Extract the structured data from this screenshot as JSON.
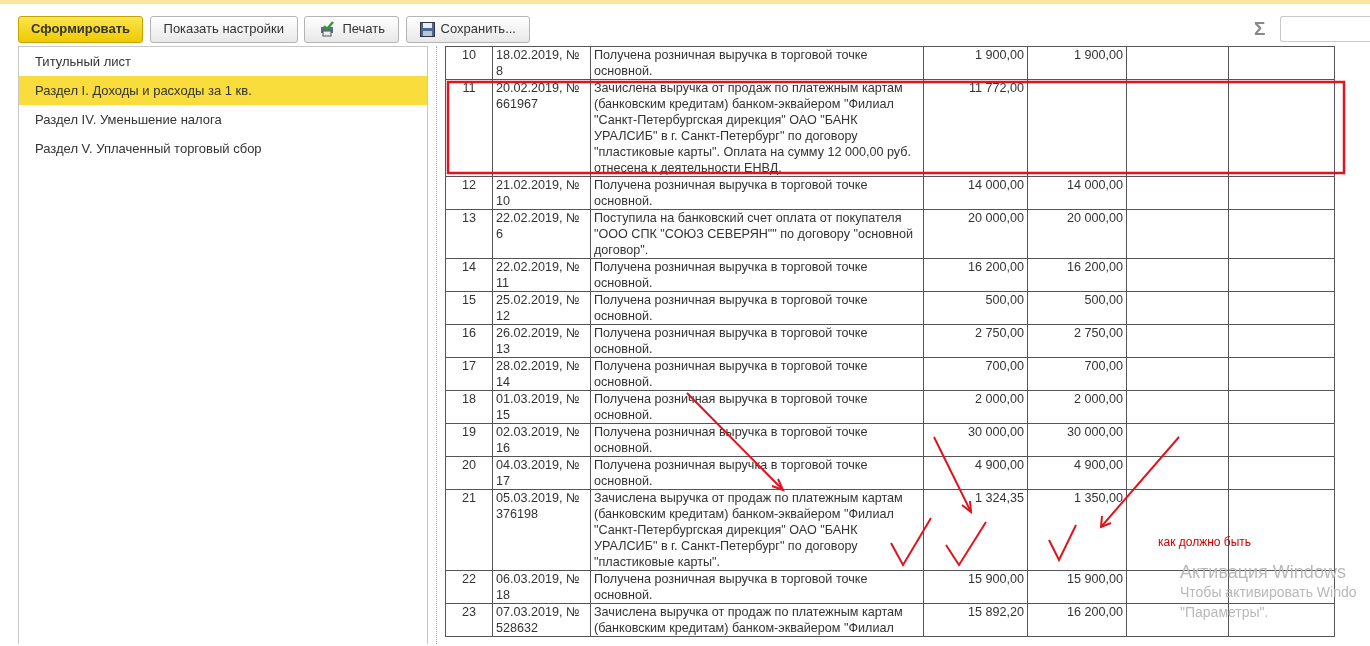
{
  "toolbar": {
    "buttons": [
      {
        "label": "Сформировать",
        "kind": "primary"
      },
      {
        "label": "Показать настройки",
        "kind": "plain"
      },
      {
        "label": "Печать",
        "kind": "print"
      },
      {
        "label": "Сохранить...",
        "kind": "save"
      }
    ],
    "sum_sign": "Σ"
  },
  "sidebar": {
    "items": [
      {
        "label": "Титульный лист",
        "selected": false
      },
      {
        "label": "Раздел I. Доходы и расходы за 1 кв.",
        "selected": true
      },
      {
        "label": "Раздел IV. Уменьшение налога",
        "selected": false
      },
      {
        "label": "Раздел V. Уплаченный торговый сбор",
        "selected": false
      }
    ]
  },
  "table": {
    "rows": [
      {
        "number": "10",
        "date": "18.02.2019, № 8",
        "description": "Получена розничная выручка в торговой точке основной.",
        "amount_1": "1 900,00",
        "amount_2": "1 900,00"
      },
      {
        "number": "11",
        "date": "20.02.2019, № 661967",
        "description": "Зачислена выручка от продаж по платежным картам (банковским кредитам) банком-эквайером \"Филиал \"Санкт-Петербургская дирекция\" ОАО \"БАНК УРАЛСИБ\" в г. Санкт-Петербург\" по договору \"пластиковые карты\". Оплата на сумму 12 000,00 руб. отнесена к деятельности ЕНВД.",
        "amount_1": "11 772,00"
      },
      {
        "number": "12",
        "date": "21.02.2019, № 10",
        "description": "Получена розничная выручка в торговой точке основной.",
        "amount_1": "14 000,00",
        "amount_2": "14 000,00"
      },
      {
        "number": "13",
        "date": "22.02.2019, № 6",
        "description": "Поступила на банковский счет оплата от покупателя \"ООО СПК \"СОЮЗ СЕВЕРЯН\"\" по договору \"основной договор\".",
        "amount_1": "20 000,00",
        "amount_2": "20 000,00"
      },
      {
        "number": "14",
        "date": "22.02.2019, № 11",
        "description": "Получена розничная выручка в торговой точке основной.",
        "amount_1": "16 200,00",
        "amount_2": "16 200,00"
      },
      {
        "number": "15",
        "date": "25.02.2019, № 12",
        "description": "Получена розничная выручка в торговой точке основной.",
        "amount_1": "500,00",
        "amount_2": "500,00"
      },
      {
        "number": "16",
        "date": "26.02.2019, № 13",
        "description": "Получена розничная выручка в торговой точке основной.",
        "amount_1": "2 750,00",
        "amount_2": "2 750,00"
      },
      {
        "number": "17",
        "date": "28.02.2019, № 14",
        "description": "Получена розничная выручка в торговой точке основной.",
        "amount_1": "700,00",
        "amount_2": "700,00"
      },
      {
        "number": "18",
        "date": "01.03.2019, № 15",
        "description": "Получена розничная выручка в торговой точке основной.",
        "amount_1": "2 000,00",
        "amount_2": "2 000,00"
      },
      {
        "number": "19",
        "date": "02.03.2019, № 16",
        "description": "Получена розничная выручка в торговой точке основной.",
        "amount_1": "30 000,00",
        "amount_2": "30 000,00"
      },
      {
        "number": "20",
        "date": "04.03.2019, № 17",
        "description": "Получена розничная выручка в торговой точке основной.",
        "amount_1": "4 900,00",
        "amount_2": "4 900,00"
      },
      {
        "number": "21",
        "date": "05.03.2019, № 376198",
        "description": "Зачислена выручка от продаж по платежным картам (банковским кредитам) банком-эквайером \"Филиал \"Санкт-Петербургская дирекция\" ОАО \"БАНК УРАЛСИБ\" в г. Санкт-Петербург\" по договору \"пластиковые карты\".",
        "amount_1": "1 324,35",
        "amount_2": "1 350,00"
      },
      {
        "number": "22",
        "date": "06.03.2019, № 18",
        "description": "Получена розничная выручка в торговой точке основной.",
        "amount_1": "15 900,00",
        "amount_2": "15 900,00"
      },
      {
        "number": "23",
        "date": "07.03.2019, № 528632",
        "description": "Зачислена выручка от продаж по платежным картам (банковским кредитам) банком-эквайером \"Филиал",
        "amount_1": "15 892,20",
        "amount_2": "16 200,00"
      }
    ]
  },
  "annotation_note": "как должно быть",
  "os_overlay": {
    "title": "Активация Windows",
    "line_1": "Чтобы активировать Windo",
    "line_2": "\"Параметры\"."
  }
}
